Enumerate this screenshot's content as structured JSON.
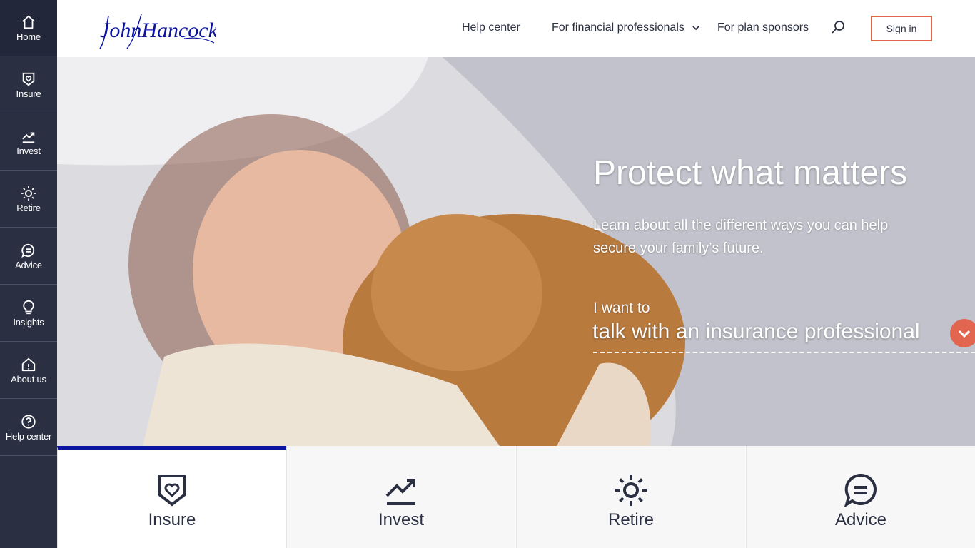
{
  "sidebar": {
    "items": [
      {
        "label": "Home",
        "icon": "home-icon"
      },
      {
        "label": "Insure",
        "icon": "shield-heart-icon"
      },
      {
        "label": "Invest",
        "icon": "trending-up-icon"
      },
      {
        "label": "Retire",
        "icon": "sun-icon"
      },
      {
        "label": "Advice",
        "icon": "chat-icon"
      },
      {
        "label": "Insights",
        "icon": "lightbulb-icon"
      },
      {
        "label": "About us",
        "icon": "house-info-icon"
      },
      {
        "label": "Help center",
        "icon": "question-icon"
      }
    ]
  },
  "header": {
    "logo_text": "JohnHancock",
    "nav": {
      "help_center": "Help center",
      "financial_professionals": "For financial professionals",
      "plan_sponsors": "For plan sponsors"
    },
    "sign_in": "Sign in"
  },
  "hero": {
    "title": "Protect what matters",
    "subtitle": "Learn about all the different ways you can help secure your family’s future.",
    "i_want_to": "I want to",
    "selected_option": "talk with an insurance professional"
  },
  "tabs": [
    {
      "label": "Insure",
      "icon": "shield-heart-icon",
      "active": true
    },
    {
      "label": "Invest",
      "icon": "trending-up-icon",
      "active": false
    },
    {
      "label": "Retire",
      "icon": "sun-icon",
      "active": false
    },
    {
      "label": "Advice",
      "icon": "chat-icon",
      "active": false
    }
  ],
  "colors": {
    "sidebar_bg": "#2b2f42",
    "accent": "#e2654f",
    "brand_blue": "#0b14a0",
    "text_dark": "#2b2f42"
  }
}
